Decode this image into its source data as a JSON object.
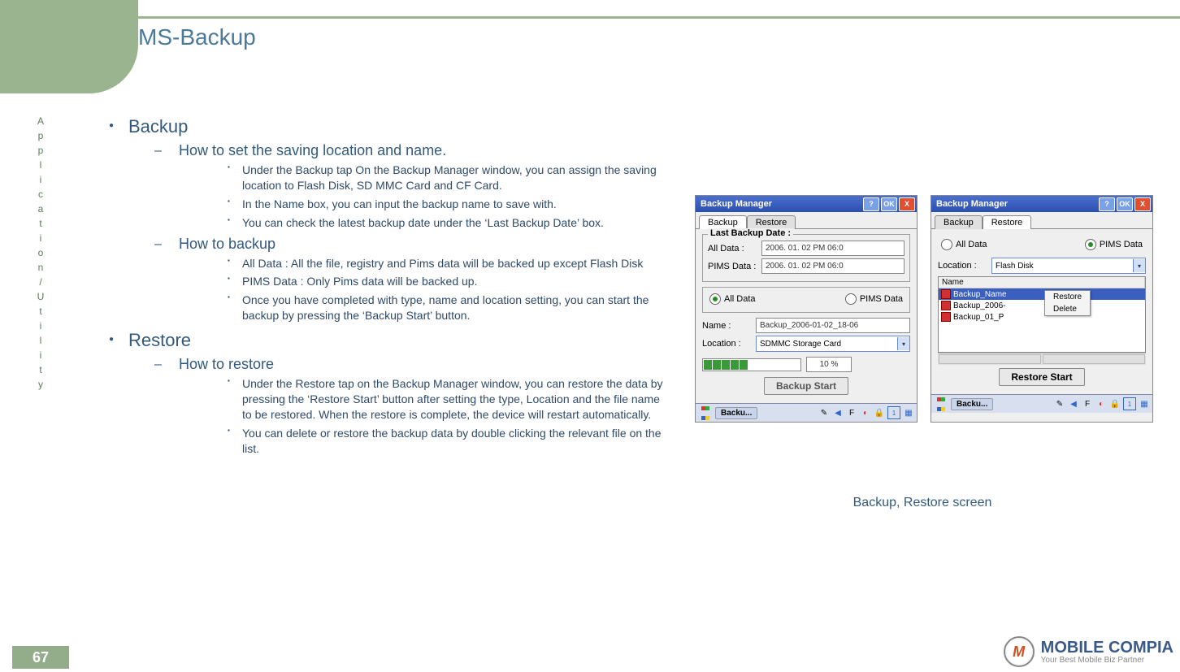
{
  "page_title": "MS-Backup",
  "page_number": "67",
  "side_label": "Application/Utility",
  "sections": {
    "backup_h": "Backup",
    "backup_s1_h": "How to set the saving location and name.",
    "backup_s1_b1": "Under the Backup tap On the Backup Manager window, you can assign the saving location to Flash Disk, SD MMC Card and CF Card.",
    "backup_s1_b2": "In the Name box, you can input the backup name to save with.",
    "backup_s1_b3": "You can check the latest backup date under the ‘Last Backup Date’ box.",
    "backup_s2_h": "How to backup",
    "backup_s2_b1": "All Data : All the file, registry and Pims data will be backed up except Flash Disk",
    "backup_s2_b2": "PIMS Data : Only Pims data will be backed up.",
    "backup_s2_b3": "Once you have completed with type, name and location setting, you can start the backup by pressing the ‘Backup Start’ button.",
    "restore_h": "Restore",
    "restore_s1_h": "How to restore",
    "restore_s1_b1": "Under the Restore tap on the Backup Manager window, you can restore the data by pressing the ‘Restore Start’ button after setting the type, Location and the file name to be restored. When the restore is complete, the device will restart automatically.",
    "restore_s1_b2": "You can delete or restore the backup data by double clicking the relevant file on the list."
  },
  "screenshot": {
    "caption": "Backup, Restore screen",
    "app_title": "Backup Manager",
    "btn_ok": "OK",
    "btn_help": "?",
    "btn_close": "X",
    "tab_backup": "Backup",
    "tab_restore": "Restore",
    "backup": {
      "group_legend": "Last Backup Date :",
      "all_data_label": "All Data :",
      "pims_data_label": "PIMS Data :",
      "all_date": "2006. 01. 02 PM 06:0",
      "pims_date": "2006. 01. 02 PM 06:0",
      "radio_all": "All Data",
      "radio_pims": "PIMS Data",
      "name_label": "Name :",
      "name_value": "Backup_2006-01-02_18-06",
      "location_label": "Location :",
      "location_value": "SDMMC Storage Card",
      "progress_pct": "10 %",
      "start_btn": "Backup Start"
    },
    "restore": {
      "radio_all": "All Data",
      "radio_pims": "PIMS Data",
      "location_label": "Location :",
      "location_value": "Flash Disk",
      "list_header": "Name",
      "files": [
        "Backup_Name",
        "Backup_2006-",
        "Backup_01_P"
      ],
      "ctx_restore": "Restore",
      "ctx_delete": "Delete",
      "start_btn": "Restore Start"
    },
    "task_label": "Backu..."
  },
  "logo": {
    "brand": "MOBILE COMPIA",
    "tagline": "Your Best Mobile Biz Partner",
    "mark": "M"
  }
}
